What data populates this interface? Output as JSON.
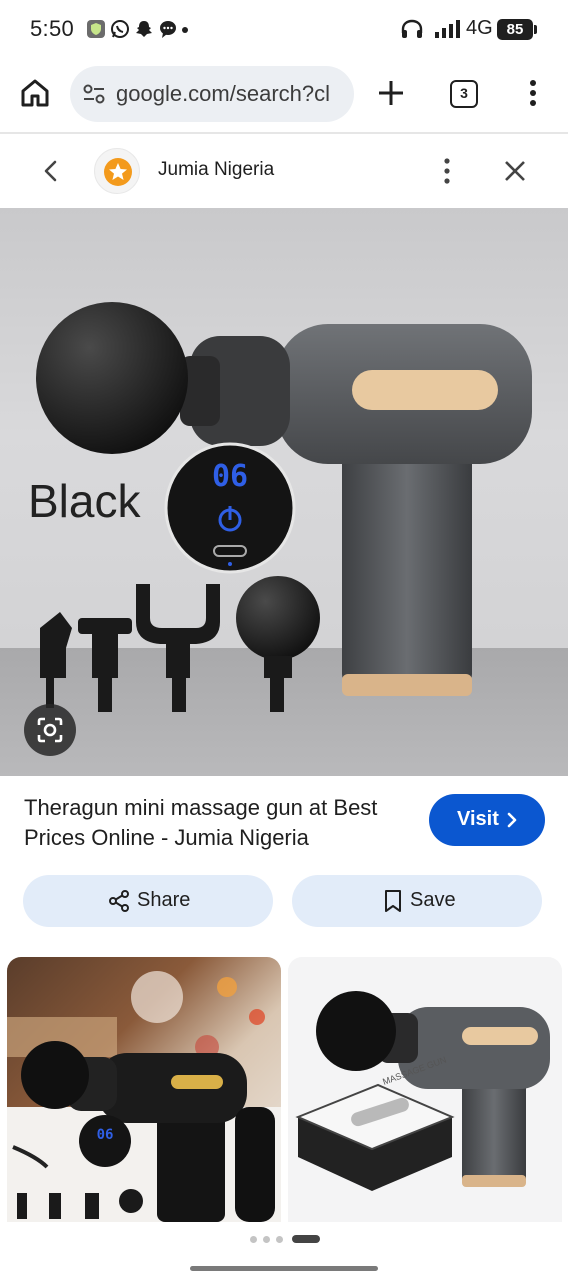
{
  "status_bar": {
    "time": "5:50",
    "network": "4G",
    "battery": "85"
  },
  "browser": {
    "url": "google.com/search?cl",
    "tab_count": "3"
  },
  "source": {
    "name": "Jumia Nigeria"
  },
  "hero": {
    "image_text": "Black",
    "display_text": "06"
  },
  "result": {
    "title": "Theragun mini massage gun at Best Prices Online - Jumia Nigeria",
    "visit_label": "Visit"
  },
  "actions": {
    "share_label": "Share",
    "save_label": "Save"
  },
  "related": {
    "thumb1_display": "06",
    "thumb2_box_text": "MASSAGE GUN"
  },
  "pager": {
    "count": 4,
    "active": 4
  },
  "colors": {
    "accent": "#0b57d0",
    "action_bg": "#e2ecf9",
    "gun_body": "#55585c",
    "gold_accent": "#e8c9a0"
  }
}
